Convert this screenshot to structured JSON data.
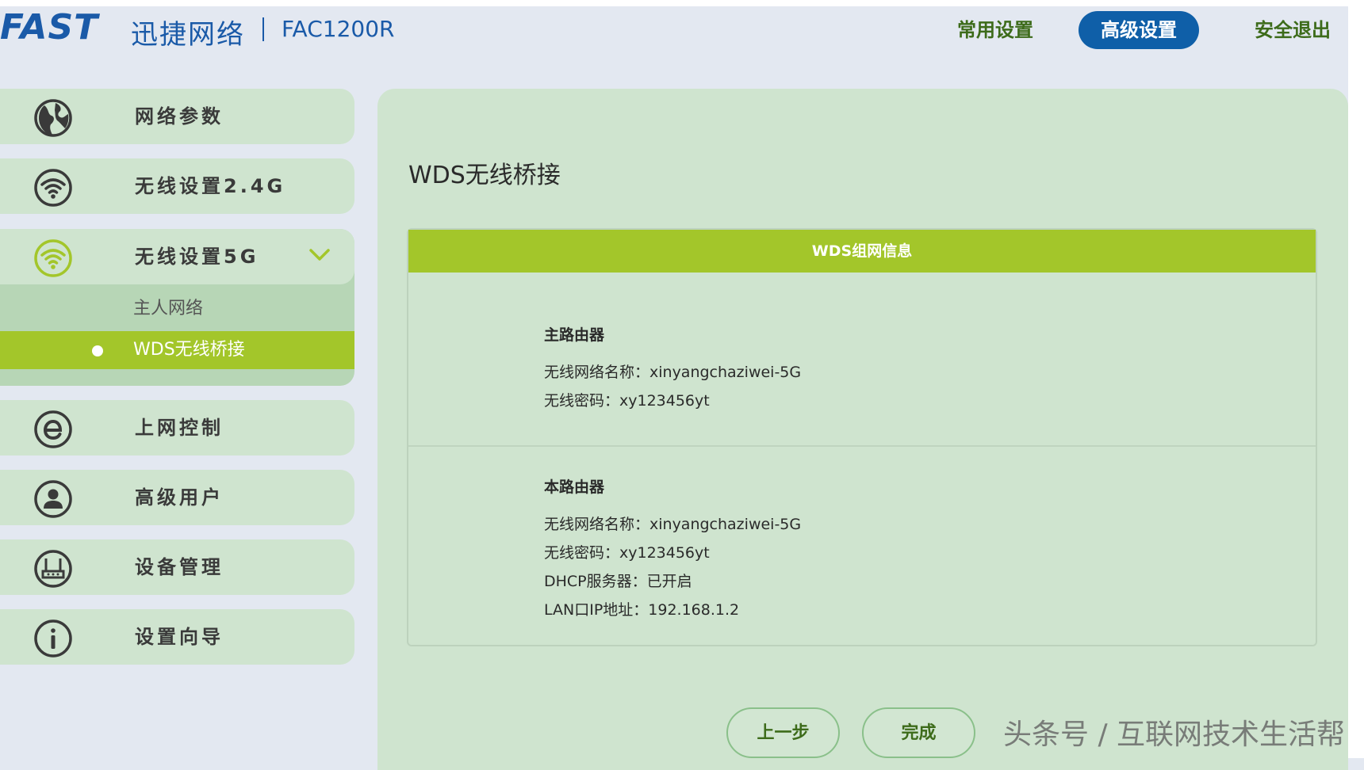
{
  "header": {
    "brand": "FAST",
    "brand_cn": "迅捷网络",
    "model": "FAC1200R",
    "nav": {
      "common": "常用设置",
      "advanced": "高级设置",
      "logout": "安全退出"
    }
  },
  "sidebar": {
    "items": [
      {
        "label": "网络参数",
        "icon": "globe-icon"
      },
      {
        "label": "无线设置2.4G",
        "icon": "wifi-icon"
      },
      {
        "label": "无线设置5G",
        "icon": "wifi-icon",
        "expanded": true,
        "children": [
          {
            "label": "主人网络"
          },
          {
            "label": "WDS无线桥接",
            "active": true
          }
        ]
      },
      {
        "label": "上网控制",
        "icon": "internet-e-icon"
      },
      {
        "label": "高级用户",
        "icon": "user-icon"
      },
      {
        "label": "设备管理",
        "icon": "router-icon"
      },
      {
        "label": "设置向导",
        "icon": "info-icon"
      }
    ]
  },
  "main": {
    "title": "WDS无线桥接",
    "box_header": "WDS组网信息",
    "primary_router": {
      "title": "主路由器",
      "ssid_row": "无线网络名称：xinyangchaziwei-5G",
      "password_row": "无线密码：xy123456yt"
    },
    "this_router": {
      "title": "本路由器",
      "ssid_row": "无线网络名称：xinyangchaziwei-5G",
      "password_row": "无线密码：xy123456yt",
      "dhcp_row": "DHCP服务器：已开启",
      "lan_ip_row": "LAN口IP地址：192.168.1.2"
    },
    "buttons": {
      "prev": "上一步",
      "done": "完成"
    }
  },
  "watermark": "头条号 / 互联网技术生活帮",
  "colors": {
    "brand_blue": "#1a5aa8",
    "accent_green": "#a3c62a",
    "panel_green": "#cfe4cf",
    "nav_active": "#0f5fa8"
  }
}
